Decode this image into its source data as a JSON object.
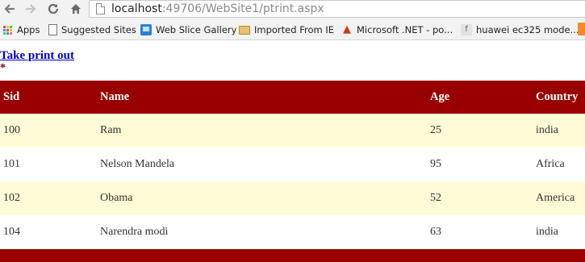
{
  "browser": {
    "url_host": "localhost",
    "url_path": ":49706/WebSite1/ptrint.aspx",
    "nav": {
      "back_icon": "back-arrow-icon",
      "forward_icon": "forward-arrow-icon",
      "reload_icon": "reload-icon",
      "home_icon": "home-icon"
    },
    "bookmarks": [
      {
        "label": "Apps",
        "icon": "apps-grid-icon"
      },
      {
        "label": "Suggested Sites",
        "icon": "page-icon"
      },
      {
        "label": "Web Slice Gallery",
        "icon": "web-slice-icon"
      },
      {
        "label": "Imported From IE",
        "icon": "folder-icon"
      },
      {
        "label": "Microsoft .NET - po...",
        "icon": "microsoft-icon"
      },
      {
        "label": "huawei ec325 mode...",
        "icon": "facebook-icon"
      }
    ]
  },
  "page": {
    "print_link": "Take print out",
    "asterisk": "*",
    "table": {
      "headers": [
        "Sid",
        "Name",
        "Age",
        "Country"
      ],
      "rows": [
        [
          "100",
          "Ram",
          "25",
          "india"
        ],
        [
          "101",
          "Nelson Mandela",
          "95",
          "Africa"
        ],
        [
          "102",
          "Obama",
          "52",
          "America"
        ],
        [
          "104",
          "Narendra modi",
          "63",
          "india"
        ]
      ]
    }
  },
  "colors": {
    "header_bg": "#990000",
    "alt_row_bg": "#fffbd6",
    "link": "#0000cc"
  }
}
